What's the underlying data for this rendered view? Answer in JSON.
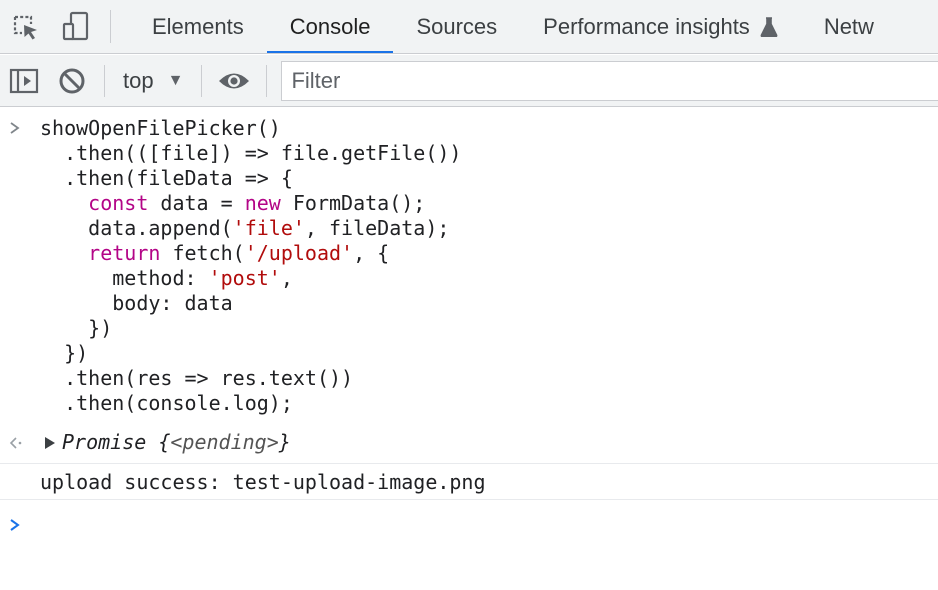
{
  "tabs": [
    {
      "label": "Elements"
    },
    {
      "label": "Console"
    },
    {
      "label": "Sources"
    },
    {
      "label": "Performance insights"
    },
    {
      "label": "Netw"
    }
  ],
  "toolbar": {
    "context": "top",
    "filter_placeholder": "Filter"
  },
  "console": {
    "input_lines": [
      "showOpenFilePicker()",
      "  .then(([file]) => file.getFile())",
      "  .then(fileData => {",
      "    const data = new FormData();",
      "    data.append('file', fileData);",
      "    return fetch('/upload', {",
      "      method: 'post',",
      "      body: data",
      "    })",
      "  })",
      "  .then(res => res.text())",
      "  .then(console.log);"
    ],
    "result": {
      "type_label": "Promise",
      "open_brace": " {",
      "state": "<pending>",
      "close_brace": "}"
    },
    "log_output": "upload success: test-upload-image.png"
  },
  "colors": {
    "accent": "#1a73e8",
    "keyword": "#b30587",
    "string": "#b10c0c"
  },
  "icons": [
    "inspect-element-icon",
    "device-toolbar-icon",
    "flask-icon",
    "sidebar-toggle-icon",
    "clear-console-icon",
    "eye-icon",
    "prompt-chevron-icon",
    "result-arrow-icon",
    "expand-triangle-icon"
  ]
}
